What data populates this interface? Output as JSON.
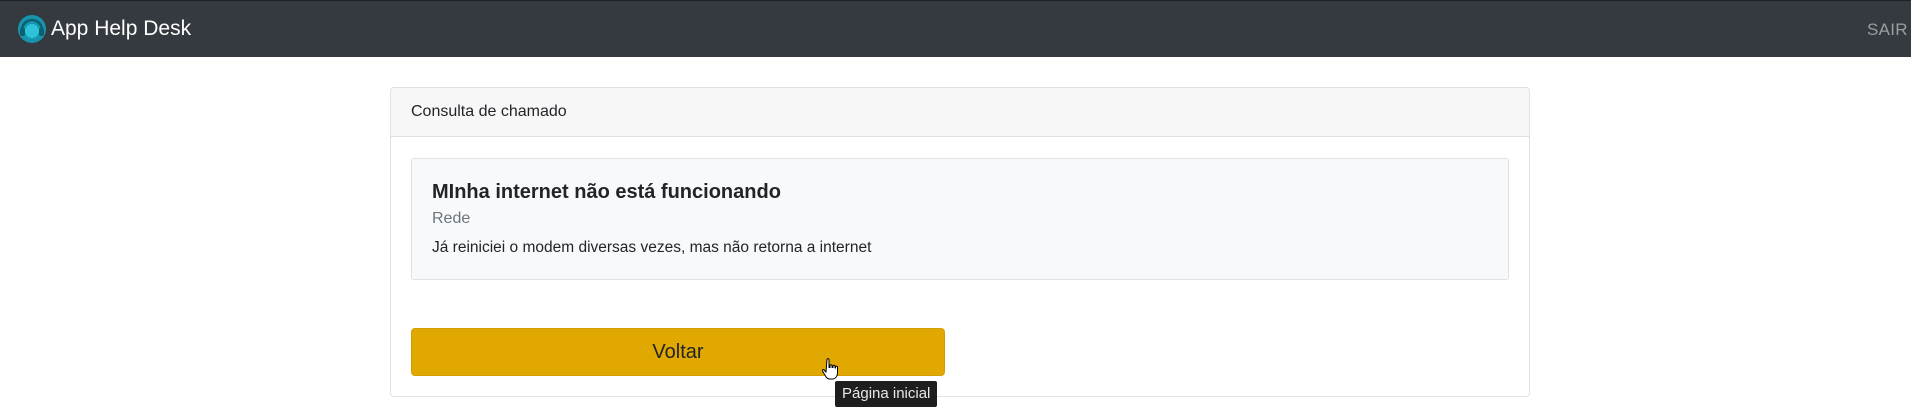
{
  "navbar": {
    "brand_logo_icon": "headset-icon",
    "brand_title": "App Help Desk",
    "logout_label": "SAIR"
  },
  "card": {
    "header_title": "Consulta de chamado",
    "ticket": {
      "title": "MInha internet não está funcionando",
      "category": "Rede",
      "description": "Já reiniciei o modem diversas vezes, mas não retorna a internet"
    },
    "back_button_label": "Voltar"
  },
  "tooltip": {
    "text": "Página inicial"
  },
  "colors": {
    "navbar_bg": "#343a40",
    "button_bg": "#e0a800",
    "logo_accent": "#17a2b8"
  }
}
